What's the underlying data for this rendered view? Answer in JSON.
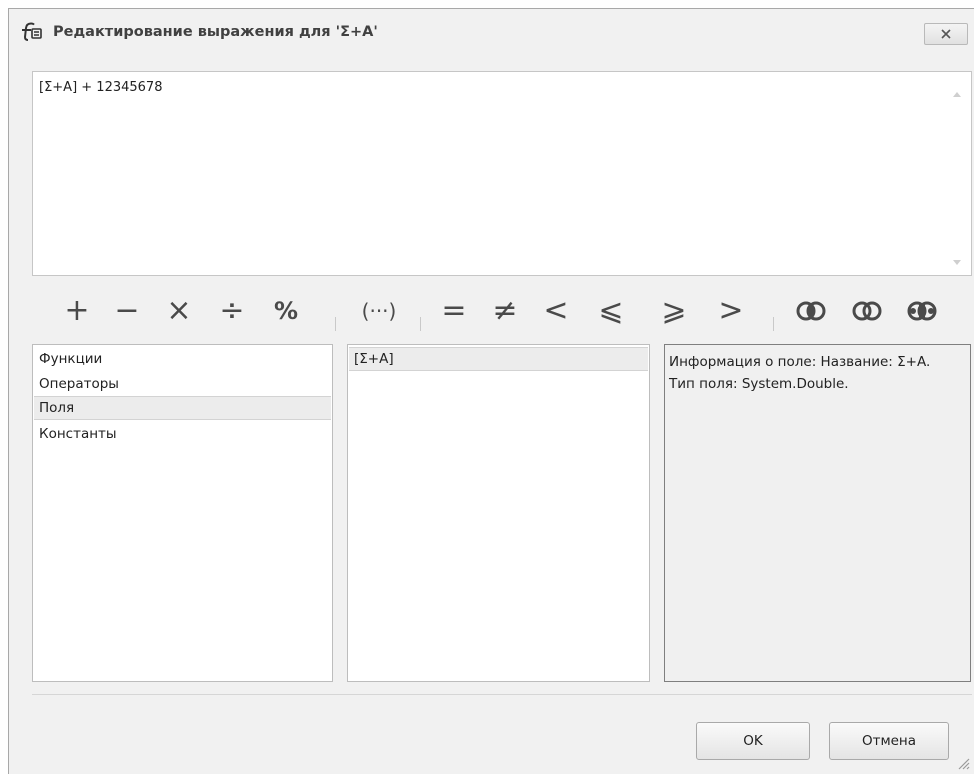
{
  "window": {
    "title": "Редактирование выражения для 'Σ+A'",
    "close_glyph": "x"
  },
  "editor": {
    "expression": "[Σ+A] + 12345678"
  },
  "operators": {
    "arithmetic": [
      "+",
      "−",
      "×",
      "÷",
      "%"
    ],
    "grouping": [
      "(···)"
    ],
    "comparison": [
      "=",
      "≠",
      "<",
      "⩽",
      "⩾",
      ">"
    ],
    "logical_icons": [
      "logical-and-icon",
      "logical-or-icon",
      "logical-not-icon"
    ]
  },
  "categories": {
    "items": [
      "Функции",
      "Операторы",
      "Поля",
      "Константы"
    ],
    "selected_index": 2
  },
  "fields": {
    "items": [
      "[Σ+A]"
    ],
    "selected_index": 0
  },
  "info": {
    "text": "Информация о поле: Название: Σ+A. Тип поля: System.Double."
  },
  "buttons": {
    "ok_label": "OK",
    "cancel_label": "Отмена"
  },
  "colors": {
    "icon": "#4a4a4a",
    "window_bg": "#f1f1f1",
    "selection_bg": "#ececec"
  }
}
